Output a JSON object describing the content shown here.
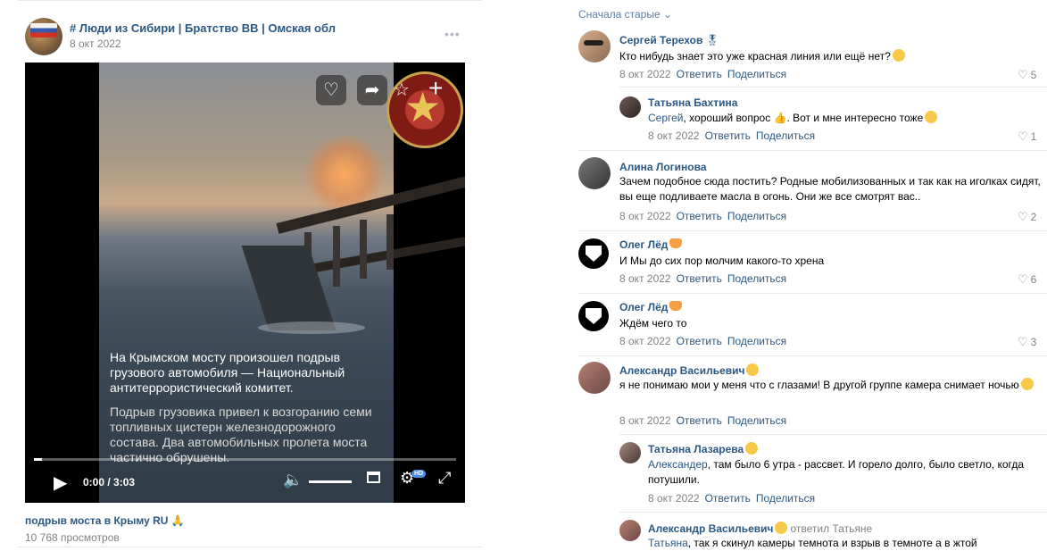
{
  "post": {
    "group_name": "# Люди из Сибири | Братство ВВ | Омская обл",
    "date": "8 окт 2022",
    "menu_icon": "more-horizontal-icon",
    "video": {
      "caption_main": "На Крымском мосту произошел подрыв грузового автомобиля — Национальный антитеррористический комитет.",
      "caption_sub": "Подрыв грузовика привел к возгоранию семи топливных цистерн железнодорожного состава. Два автомобильных пролета моста частично обрушены.",
      "time": "0:00 / 3:03",
      "progress": 0.02,
      "hd_label": "HD",
      "icons": [
        "heart-icon",
        "share-icon",
        "star-icon",
        "plus-icon",
        "play-icon",
        "volume-icon",
        "miniplayer-icon",
        "settings-icon",
        "fullscreen-icon"
      ]
    },
    "title": "подрыв моста в Крыму RU",
    "views": "10 768 просмотров"
  },
  "comments": {
    "sort_label": "Сначала старые ⌄",
    "reply_label": "Ответить",
    "share_label": "Поделиться",
    "items": [
      {
        "author": "Сергей Терехов",
        "text": "Кто нибудь знает это уже красная линия или ещё нет?",
        "date": "8 окт 2022",
        "likes": "5"
      },
      {
        "author": "Татьяна Бахтина",
        "address": "Сергей",
        "text": ", хороший вопрос 👍. Вот и мне интересно тоже",
        "date": "8 окт 2022",
        "likes": "1"
      },
      {
        "author": "Алина Логинова",
        "text": "Зачем подобное сюда постить? Родные мобилизованных и так как на иголках сидят, вы еще подливаете масла в огонь. Они же все смотрят вас..",
        "date": "8 окт 2022",
        "likes": "2"
      },
      {
        "author": "Олег Лёд",
        "text": "И Мы до сих пор молчим какого-то хрена",
        "date": "8 окт 2022",
        "likes": "6"
      },
      {
        "author": "Олег Лёд",
        "text": "Ждём чего то",
        "date": "8 окт 2022",
        "likes": "3"
      },
      {
        "author": "Александр Васильевич",
        "text": "я не понимаю мои у меня что с глазами! В другой группе камера снимает ночью",
        "date": "8 окт 2022",
        "likes": ""
      },
      {
        "author": "Татьяна Лазарева",
        "address": "Александер",
        "text": ", там было 6 утра - рассвет. И горело долго, было светло, когда потушили.",
        "date": "8 окт 2022",
        "likes": ""
      },
      {
        "author": "Александр Васильевич",
        "reply_to": "ответил Татьяне",
        "address": "Татьяна",
        "text": ", так я скинул камеры темнота и взрыв в темноте а в жтой",
        "date": "",
        "likes": ""
      }
    ]
  },
  "colors": {
    "link": "#2a5885",
    "muted": "#828282",
    "separator": "#e7e8ec"
  }
}
